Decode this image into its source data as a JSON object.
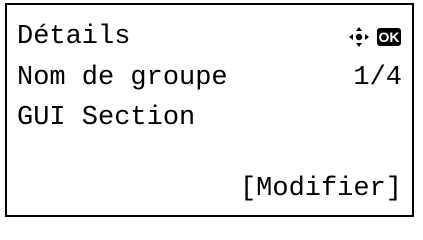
{
  "screen": {
    "title": "Détails",
    "field_label": "Nom de groupe",
    "page_indicator": "1/4",
    "field_value": "GUI Section",
    "softkey_label": "[Modifier]"
  },
  "icons": {
    "navigation": "four-way-nav-icon",
    "ok": "OK"
  }
}
